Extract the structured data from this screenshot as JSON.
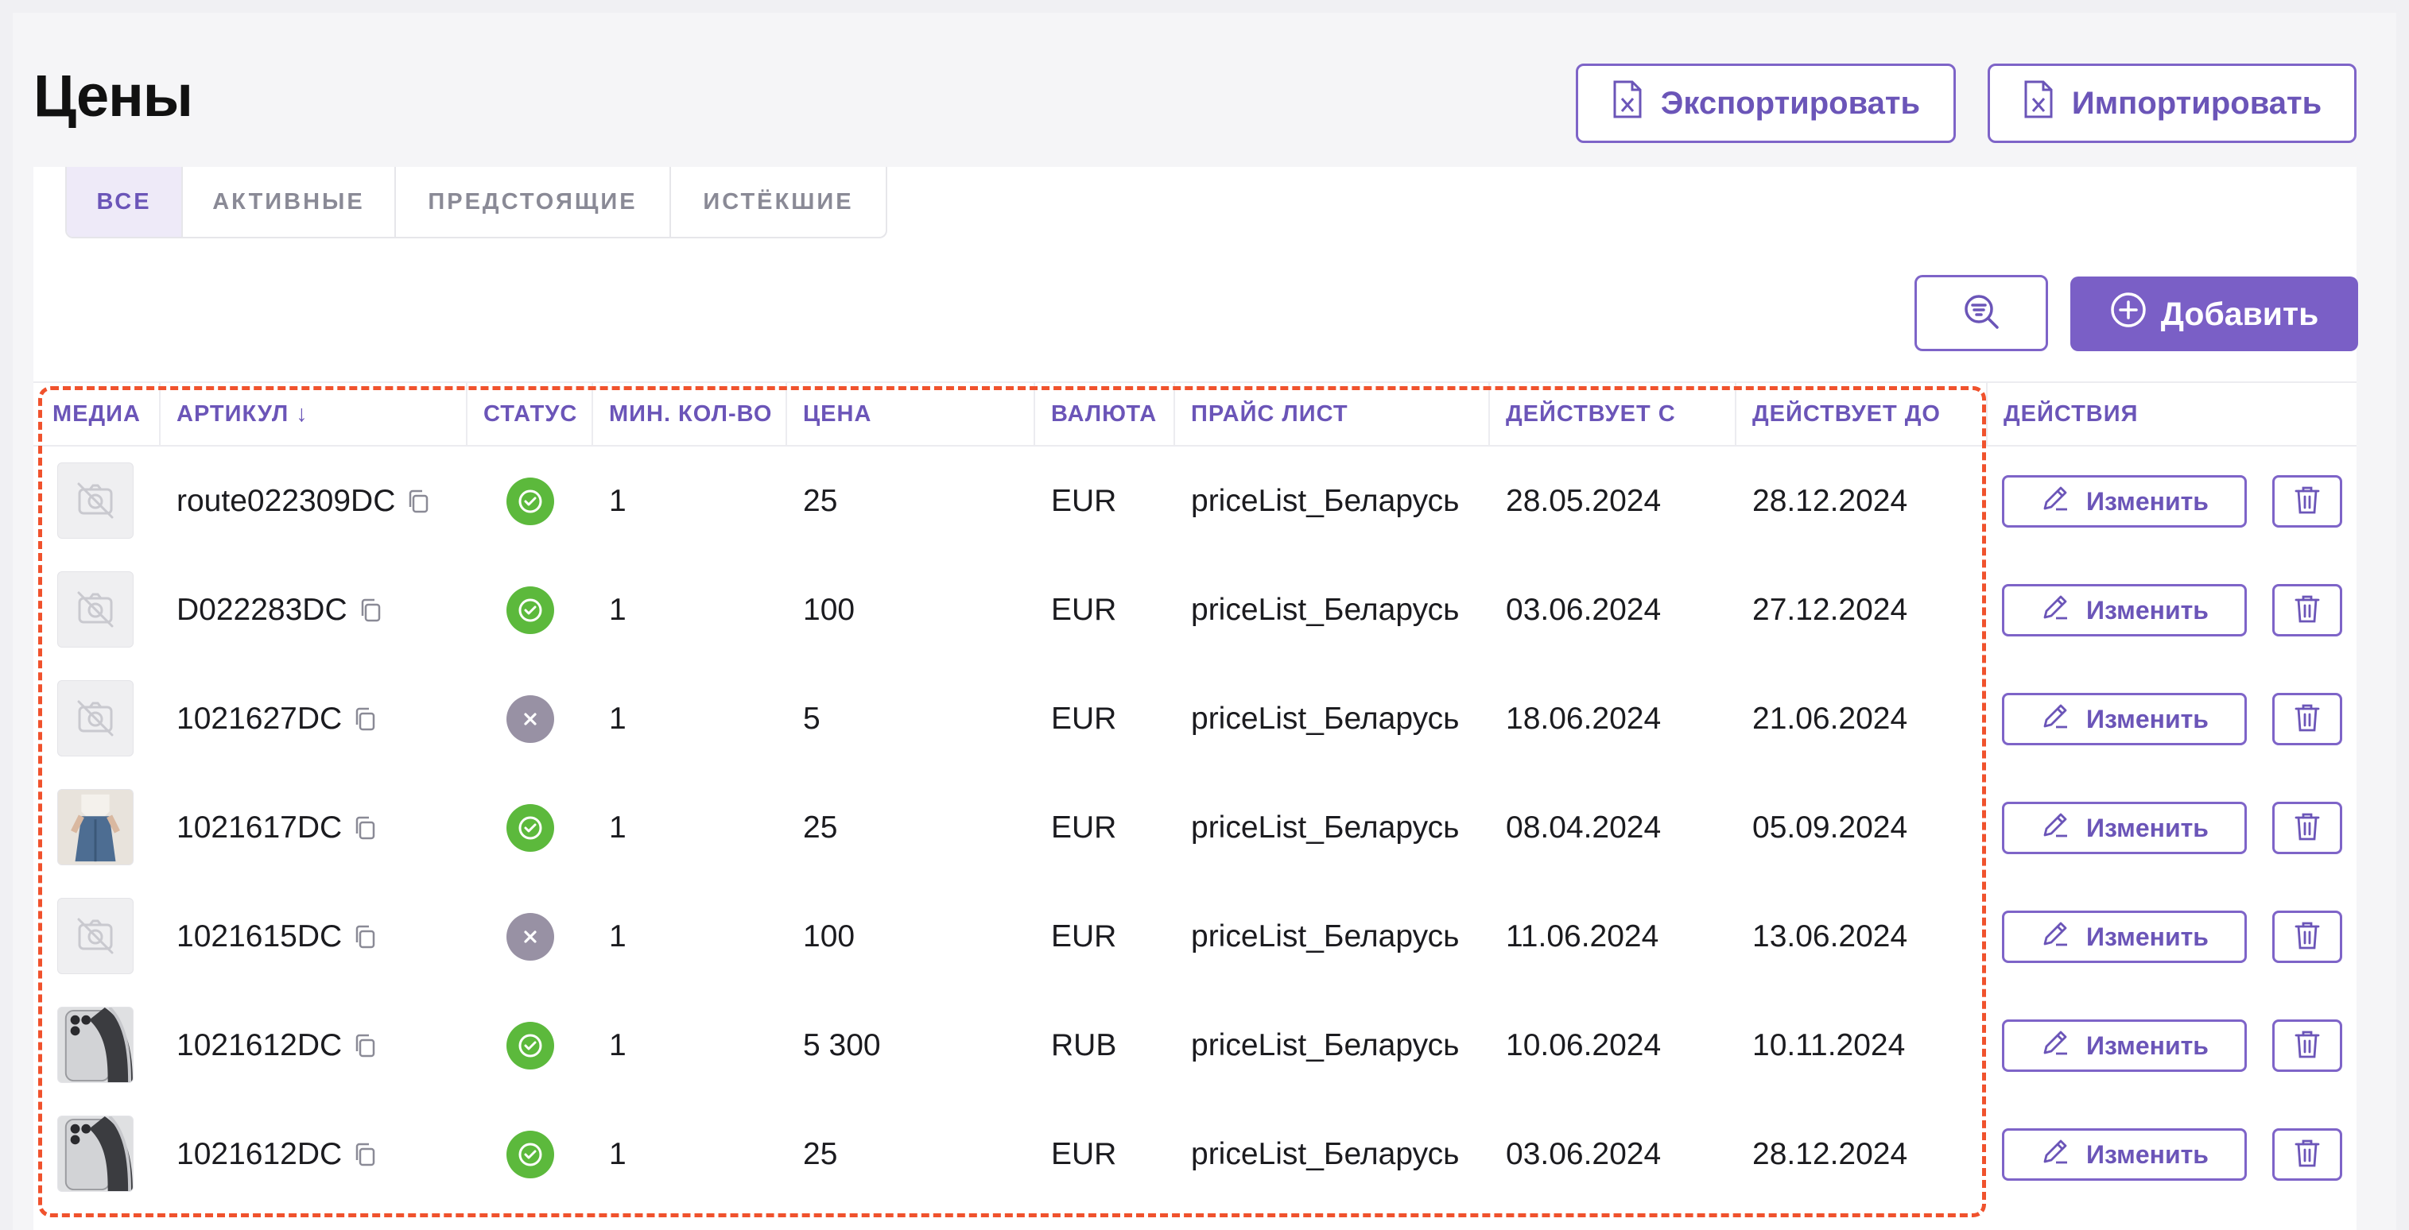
{
  "page": {
    "title": "Цены",
    "export_label": "Экспортировать",
    "import_label": "Импортировать"
  },
  "tabs": [
    {
      "label": "ВСЕ",
      "active": true
    },
    {
      "label": "АКТИВНЫЕ",
      "active": false
    },
    {
      "label": "ПРЕДСТОЯЩИЕ",
      "active": false
    },
    {
      "label": "ИСТЁКШИЕ",
      "active": false
    }
  ],
  "toolbar": {
    "add_label": "Добавить",
    "filter_icon": "search-filter-icon"
  },
  "table": {
    "columns": {
      "media": "МЕДИА",
      "sku": "АРТИКУЛ ↓",
      "status": "СТАТУС",
      "min_qty": "МИН. КОЛ-ВО",
      "price": "ЦЕНА",
      "currency": "ВАЛЮТА",
      "price_list": "ПРАЙС ЛИСТ",
      "valid_from": "ДЕЙСТВУЕТ С",
      "valid_to": "ДЕЙСТВУЕТ ДО",
      "actions": "ДЕЙСТВИЯ"
    },
    "edit_label": "Изменить",
    "rows": [
      {
        "media": "placeholder",
        "sku": "route022309DC",
        "status": "active",
        "min_qty": "1",
        "price": "25",
        "currency": "EUR",
        "price_list": "priceList_Беларусь",
        "valid_from": "28.05.2024",
        "valid_to": "28.12.2024"
      },
      {
        "media": "placeholder",
        "sku": "D022283DC",
        "status": "active",
        "min_qty": "1",
        "price": "100",
        "currency": "EUR",
        "price_list": "priceList_Беларусь",
        "valid_from": "03.06.2024",
        "valid_to": "27.12.2024"
      },
      {
        "media": "placeholder",
        "sku": "1021627DC",
        "status": "inactive",
        "min_qty": "1",
        "price": "5",
        "currency": "EUR",
        "price_list": "priceList_Беларусь",
        "valid_from": "18.06.2024",
        "valid_to": "21.06.2024"
      },
      {
        "media": "clothing-photo",
        "sku": "1021617DC",
        "status": "active",
        "min_qty": "1",
        "price": "25",
        "currency": "EUR",
        "price_list": "priceList_Беларусь",
        "valid_from": "08.04.2024",
        "valid_to": "05.09.2024"
      },
      {
        "media": "placeholder",
        "sku": "1021615DC",
        "status": "inactive",
        "min_qty": "1",
        "price": "100",
        "currency": "EUR",
        "price_list": "priceList_Беларусь",
        "valid_from": "11.06.2024",
        "valid_to": "13.06.2024"
      },
      {
        "media": "phone-photo",
        "sku": "1021612DC",
        "status": "active",
        "min_qty": "1",
        "price": "5 300",
        "currency": "RUB",
        "price_list": "priceList_Беларусь",
        "valid_from": "10.06.2024",
        "valid_to": "10.11.2024"
      },
      {
        "media": "phone-photo",
        "sku": "1021612DC",
        "status": "active",
        "min_qty": "1",
        "price": "25",
        "currency": "EUR",
        "price_list": "priceList_Беларусь",
        "valid_from": "03.06.2024",
        "valid_to": "28.12.2024"
      }
    ]
  },
  "colors": {
    "accent": "#7a5fc6",
    "status_active": "#5cb93c",
    "status_inactive": "#9891a4",
    "highlight": "#f0522d"
  }
}
